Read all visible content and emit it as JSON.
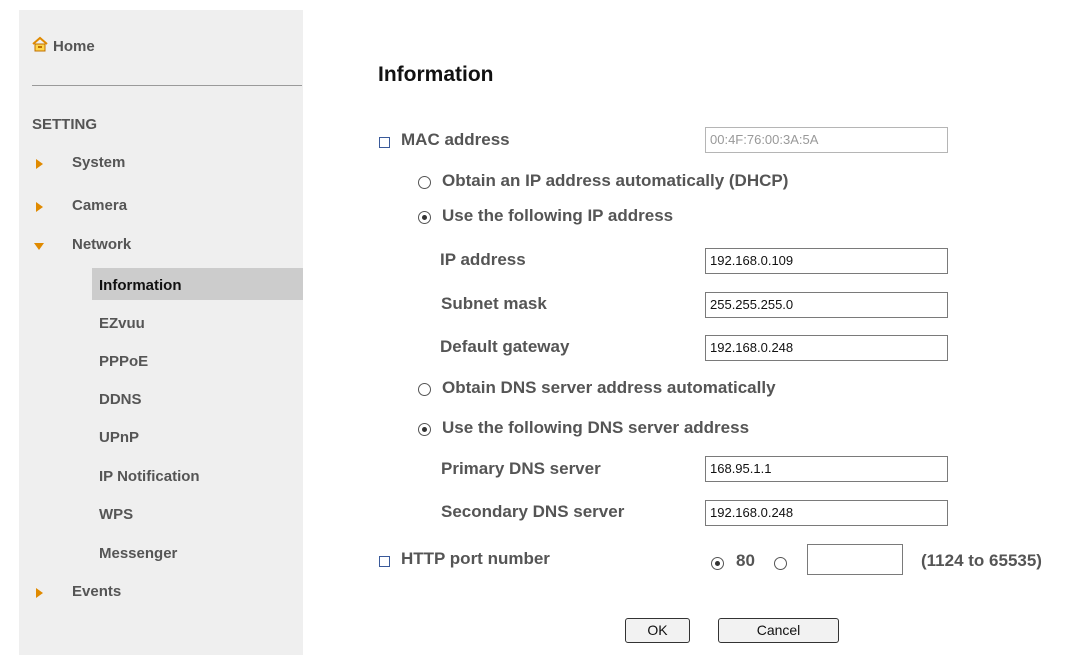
{
  "sidebar": {
    "home": "Home",
    "setting": "SETTING",
    "items": [
      {
        "label": "System"
      },
      {
        "label": "Camera"
      },
      {
        "label": "Network"
      },
      {
        "label": "Events"
      }
    ],
    "network_sub": [
      {
        "label": "Information"
      },
      {
        "label": "EZvuu"
      },
      {
        "label": "PPPoE"
      },
      {
        "label": "DDNS"
      },
      {
        "label": "UPnP"
      },
      {
        "label": "IP Notification"
      },
      {
        "label": "WPS"
      },
      {
        "label": "Messenger"
      }
    ]
  },
  "page": {
    "title": "Information",
    "mac": {
      "label": "MAC address",
      "value": "00:4F:76:00:3A:5A"
    },
    "ip_mode": {
      "dhcp_label": "Obtain an IP address automatically (DHCP)",
      "static_label": "Use the following IP address",
      "selected": "static"
    },
    "ip": {
      "label": "IP address",
      "value": "192.168.0.109"
    },
    "subnet": {
      "label": "Subnet mask",
      "value": "255.255.255.0"
    },
    "gateway": {
      "label": "Default gateway",
      "value": "192.168.0.248"
    },
    "dns_mode": {
      "auto_label": "Obtain DNS server address automatically",
      "manual_label": "Use the following DNS server address",
      "selected": "manual"
    },
    "dns1": {
      "label": "Primary DNS server",
      "value": "168.95.1.1"
    },
    "dns2": {
      "label": "Secondary DNS server",
      "value": "192.168.0.248"
    },
    "http_port": {
      "label": "HTTP port number",
      "default_label": "80",
      "custom_value": "",
      "range": "(1124 to 65535)"
    },
    "ok": "OK",
    "cancel": "Cancel"
  },
  "colors": {
    "sidebar_bg": "#efefef",
    "active_bg": "#cccccc",
    "arrow": "#e08a00"
  }
}
